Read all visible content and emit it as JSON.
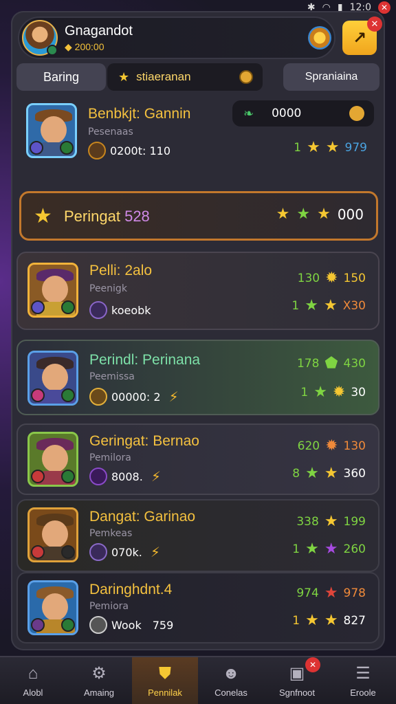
{
  "status_bar": {
    "icons": [
      "bluetooth-icon",
      "wifi-icon",
      "signal-icon",
      "battery-icon"
    ],
    "time": "12:0",
    "close": "✕"
  },
  "profile": {
    "name": "Gnagandot",
    "coins": "200:00"
  },
  "tabs": {
    "left": "Baring",
    "search": "stiaeranan",
    "right": "Spraniaina"
  },
  "rows": [
    {
      "title": "Benbkjt: Gannin",
      "sub": "Pesenaas",
      "meta": "0200t: 110",
      "counter": "0000",
      "stats_a": "1",
      "stats_b": "979"
    },
    {
      "banner_label": "Peringat",
      "banner_num": "528",
      "banner_value": "000"
    },
    {
      "title": "Pelli: 2alo",
      "sub": "Peenigk",
      "meta": "koeobk",
      "stat1": "130",
      "stat2": "150",
      "stat3": "1",
      "stat4": "X30"
    },
    {
      "title": "Perindl: Perinana",
      "sub": "Peemissa",
      "meta": "00000: 2",
      "stat1": "178",
      "stat2": "430",
      "stat3": "1",
      "stat4": "30"
    },
    {
      "title": "Geringat: Bernao",
      "sub": "Pemilora",
      "meta": "8008.",
      "stat1": "620",
      "stat2": "130",
      "stat3": "8",
      "stat4": "360"
    },
    {
      "title": "Dangat: Garinao",
      "sub": "Pemkeas",
      "meta": "070k.",
      "stat1": "338",
      "stat2": "199",
      "stat3": "1",
      "stat4": "260"
    },
    {
      "title": "Daringhdnt.4",
      "sub": "Pemiora",
      "meta": "Wook",
      "meta2": "759",
      "stat1": "974",
      "stat2": "978",
      "stat3": "1",
      "stat4": "827"
    }
  ],
  "nav": [
    {
      "label": "Alobl"
    },
    {
      "label": "Amaing"
    },
    {
      "label": "Pennilak"
    },
    {
      "label": "Conelas"
    },
    {
      "label": "Sgnfnoot"
    },
    {
      "label": "Eroole"
    }
  ]
}
